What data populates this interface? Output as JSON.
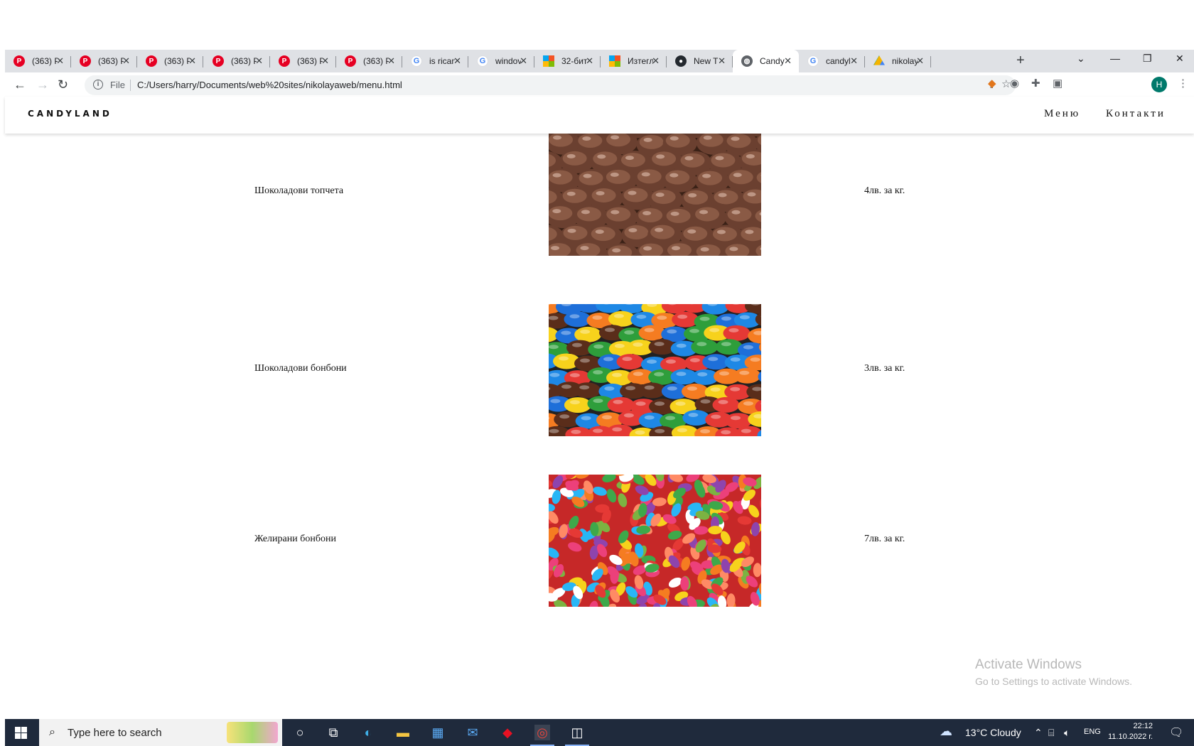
{
  "browser": {
    "tabs": [
      {
        "title": "(363) P",
        "favicon": "pinterest-icon",
        "active": false
      },
      {
        "title": "(363) P",
        "favicon": "pinterest-icon",
        "active": false
      },
      {
        "title": "(363) P",
        "favicon": "pinterest-icon",
        "active": false
      },
      {
        "title": "(363) P",
        "favicon": "pinterest-icon",
        "active": false
      },
      {
        "title": "(363) P",
        "favicon": "pinterest-icon",
        "active": false
      },
      {
        "title": "(363) P",
        "favicon": "pinterest-icon",
        "active": false
      },
      {
        "title": "is rican",
        "favicon": "google-icon",
        "active": false
      },
      {
        "title": "windov",
        "favicon": "google-icon",
        "active": false
      },
      {
        "title": "32-бит",
        "favicon": "microsoft-icon",
        "active": false
      },
      {
        "title": "Изтегл",
        "favicon": "microsoft-icon",
        "active": false
      },
      {
        "title": "New T",
        "favicon": "github-icon",
        "active": false
      },
      {
        "title": "Candy",
        "favicon": "globe-icon",
        "active": true
      },
      {
        "title": "candyl",
        "favicon": "google-icon",
        "active": false
      },
      {
        "title": "nikolay",
        "favicon": "google-drive-icon",
        "active": false
      }
    ],
    "new_tab": "+",
    "address": {
      "scheme_label": "File",
      "url": "C:/Users/harry/Documents/web%20sites/nikolayaweb/menu.html"
    },
    "profile_initial": "H"
  },
  "site": {
    "brand": "CANDYLAND",
    "nav": {
      "menu": "Меню",
      "contacts": "Контакти"
    },
    "products": [
      {
        "name": "Шоколадови топчета",
        "price": "4лв. за кг.",
        "image": "chocolate-balls"
      },
      {
        "name": "Шоколадови бонбони",
        "price": "3лв. за кг.",
        "image": "candy-coated-chocolates"
      },
      {
        "name": "Желирани бонбони",
        "price": "7лв. за кг.",
        "image": "jelly-beans"
      }
    ]
  },
  "watermark": {
    "line1": "Activate Windows",
    "line2": "Go to Settings to activate Windows."
  },
  "taskbar": {
    "search_placeholder": "Type here to search",
    "weather": "13°C  Cloudy",
    "language": "ENG",
    "time": "22:12",
    "date": "11.10.2022 г."
  },
  "colors": {
    "taskbar_bg": "#1f2a3c",
    "tabstrip_bg": "#dfe1e5",
    "profile_bg": "#00796b"
  }
}
